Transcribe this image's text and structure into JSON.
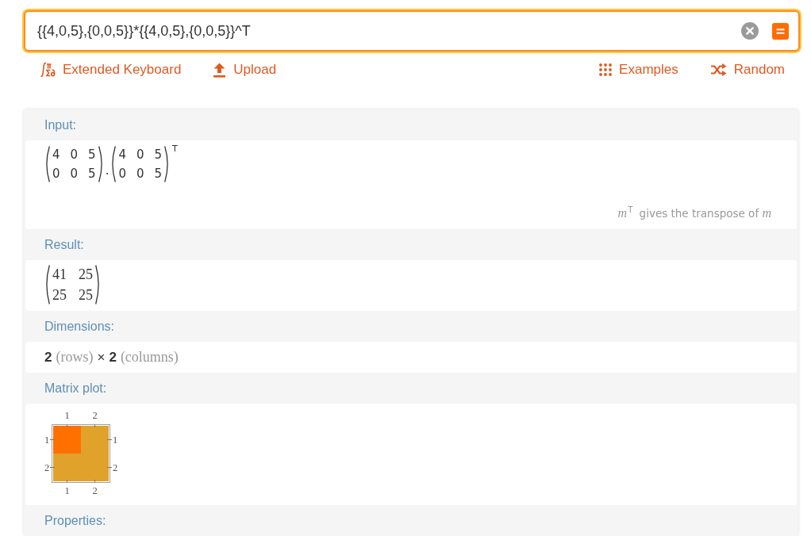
{
  "search": {
    "value": "{{4,0,5},{0,0,5}}*{{4,0,5},{0,0,5}}^T"
  },
  "toolbar": {
    "left": [
      {
        "kind": "keyboard",
        "label": "Extended Keyboard"
      },
      {
        "kind": "upload",
        "label": "Upload"
      }
    ],
    "right": [
      {
        "kind": "examples",
        "label": "Examples"
      },
      {
        "kind": "random",
        "label": "Random"
      }
    ]
  },
  "pods": [
    {
      "title": "Input:",
      "content": {
        "kind": "input",
        "terms": [
          {
            "kind": "matrix",
            "rows": [
              [
                "4",
                "0",
                "5"
              ],
              [
                "0",
                "0",
                "5"
              ]
            ]
          },
          {
            "kind": "operator",
            "text": "."
          },
          {
            "kind": "matrix",
            "rows": [
              [
                "4",
                "0",
                "5"
              ],
              [
                "0",
                "0",
                "5"
              ]
            ],
            "superscript": "T"
          }
        ],
        "note": "*m*$^{T}$ gives the transpose of *m*"
      }
    },
    {
      "title": "Result:",
      "content": {
        "kind": "matrix",
        "rows": [
          [
            "41",
            "25"
          ],
          [
            "25",
            "25"
          ]
        ]
      }
    },
    {
      "title": "Dimensions:",
      "content": {
        "kind": "dimensions",
        "parts": [
          {
            "kind": "number",
            "text": "2"
          },
          {
            "kind": "unit",
            "text": "(rows)"
          },
          {
            "kind": "operator",
            "text": "×"
          },
          {
            "kind": "number",
            "text": "2"
          },
          {
            "kind": "unit",
            "text": "(columns)"
          }
        ]
      }
    },
    {
      "title": "Matrix plot:",
      "content": {
        "kind": "matrix_plot",
        "top_ticks": [
          "1",
          "2"
        ],
        "bottom_ticks": [
          "1",
          "2"
        ],
        "left_ticks": [
          "1",
          "2"
        ],
        "right_ticks": [
          "1",
          "2"
        ],
        "cells": [
          [
            {
              "color": "#ff7000"
            },
            {
              "color": "#e0a22a"
            }
          ],
          [
            {
              "color": "#e0a22a"
            },
            {
              "color": "#e0a22a"
            }
          ]
        ]
      }
    },
    {
      "title": "Properties:"
    }
  ]
}
